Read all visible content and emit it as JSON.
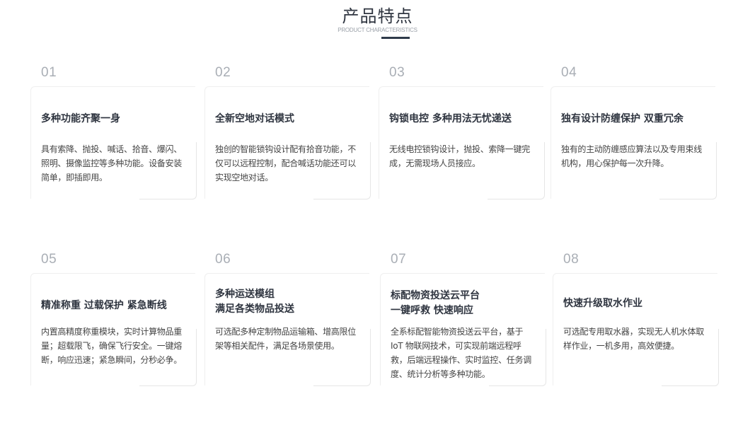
{
  "header": {
    "title": "产品特点",
    "subtitle": "PRODUCT CHARACTERISTICS"
  },
  "features": [
    {
      "num": "01",
      "title": "多种功能齐聚一身",
      "desc": "具有索降、抛投、喊话、拾音、爆闪、照明、摄像监控等多种功能。设备安装简单，即插即用。"
    },
    {
      "num": "02",
      "title": "全新空地对话模式",
      "desc": "独创的智能锁钩设计配有拾音功能，不仅可以远程控制，配合喊话功能还可以实现空地对话。"
    },
    {
      "num": "03",
      "title": "钩锁电控 多种用法无忧递送",
      "desc": "无线电控锁钩设计，抛投、索降一键完成，无需现场人员接应。"
    },
    {
      "num": "04",
      "title": "独有设计防缠保护 双重冗余",
      "desc": "独有的主动防缠感应算法以及专用束线机构，用心保护每一次升降。"
    },
    {
      "num": "05",
      "title": "精准称重 过载保护 紧急断线",
      "desc": "内置高精度称重模块，实时计算物品重量；超载限飞，确保飞行安全。一键熔断，响应迅速；紧急瞬间，分秒必争。"
    },
    {
      "num": "06",
      "title_line1": "多种运送模组",
      "title_line2": "满足各类物品投送",
      "desc": "可选配多种定制物品运输箱、增高限位架等相关配件，满足各场景使用。"
    },
    {
      "num": "07",
      "title_line1": "标配物资投送云平台",
      "title_line2": "一键呼救 快速响应",
      "desc": "全系标配智能物资投送云平台，基于 IoT 物联网技术，可实现前端远程呼救，后端远程操作、实时监控、任务调度、统计分析等多种功能。"
    },
    {
      "num": "08",
      "title": "快速升级取水作业",
      "desc": "可选配专用取水器，实现无人机水体取样作业，一机多用，高效便捷。"
    }
  ]
}
